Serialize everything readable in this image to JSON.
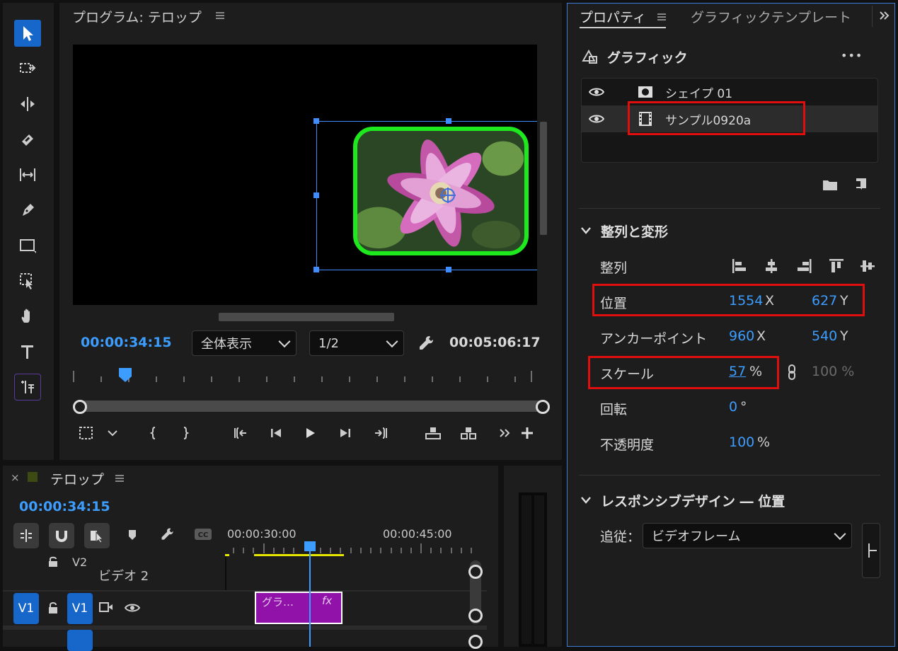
{
  "program": {
    "title": "プログラム: テロップ",
    "timecode": "00:00:34:15",
    "zoom": "全体表示",
    "resolution": "1/2",
    "duration": "00:05:06:17"
  },
  "timeline": {
    "title": "テロップ",
    "timecode": "00:00:34:15",
    "ruler_labels": [
      "00:00:30:00",
      "00:00:45:00"
    ],
    "tracks": {
      "v2_label": "V2",
      "v2_name": "ビデオ 2",
      "v1_source": "V1",
      "v1_target": "V1"
    },
    "clip": {
      "name": "グラ…",
      "fx": "fx"
    },
    "close_label": "×"
  },
  "properties": {
    "tabs": [
      "プロパティ",
      "グラフィックテンプレート"
    ],
    "section_graphic": "グラフィック",
    "more_label": "•••",
    "layers": [
      {
        "name": "シェイプ 01",
        "icon": "shape-icon"
      },
      {
        "name": "サンプル0920a",
        "icon": "film-icon"
      }
    ],
    "align_transform": {
      "title": "整列と変形",
      "align_label": "整列",
      "position_label": "位置",
      "position_x": "1554",
      "position_y": "627",
      "anchor_label": "アンカーポイント",
      "anchor_x": "960",
      "anchor_y": "540",
      "scale_label": "スケール",
      "scale_value": "57",
      "scale_unit": "%",
      "scale_linked": "100 %",
      "rotation_label": "回転",
      "rotation_value": "0",
      "rotation_unit": "°",
      "opacity_label": "不透明度",
      "opacity_value": "100",
      "opacity_unit": "%",
      "x_unit": "X",
      "y_unit": "Y"
    },
    "responsive": {
      "title": "レスポンシブデザイン ― 位置",
      "follow_label": "追従：",
      "follow_value": "ビデオフレーム"
    }
  },
  "colors": {
    "accent": "#3d9dff",
    "selection_box": "#3f8cff",
    "highlight": "#e10e0e",
    "shape_border": "#1ee81e",
    "clip": "#9012a8",
    "track_target": "#1766c9"
  }
}
